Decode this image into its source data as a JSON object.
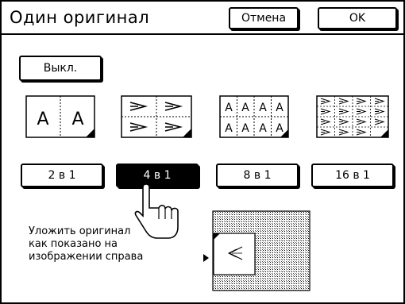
{
  "header": {
    "title": "Один оригинал",
    "cancel_label": "Отмена",
    "ok_label": "OK"
  },
  "off_button": {
    "label": "Выкл."
  },
  "modes": [
    {
      "label": "2 в 1",
      "selected": false
    },
    {
      "label": "4 в 1",
      "selected": true
    },
    {
      "label": "8 в 1",
      "selected": false
    },
    {
      "label": "16 в 1",
      "selected": false
    }
  ],
  "thumbnails": {
    "two_up_glyph": "A",
    "eight_up_glyph": "A"
  },
  "instruction": {
    "line1": "Уложить оригинал",
    "line2": "как показано на",
    "line3": "изображении справа"
  }
}
